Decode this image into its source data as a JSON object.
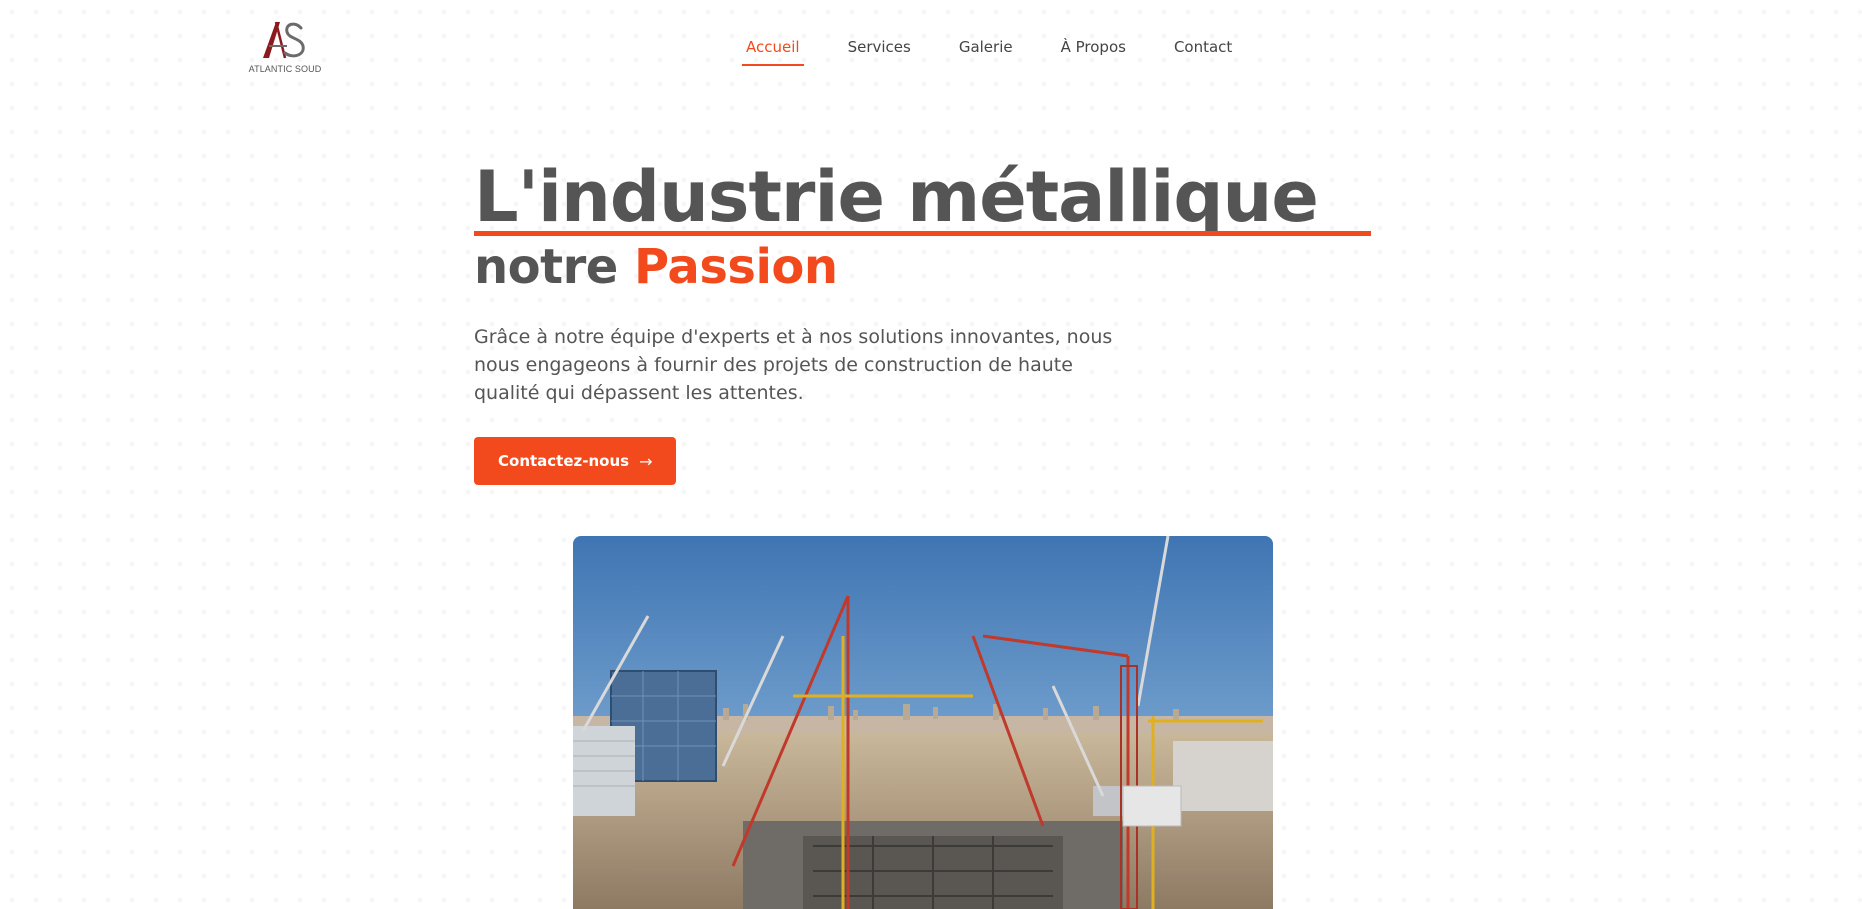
{
  "header": {
    "logo_text": "ATLANTIC SOUD",
    "logo_mark": "AS",
    "nav": [
      {
        "label": "Accueil",
        "active": true
      },
      {
        "label": "Services",
        "active": false
      },
      {
        "label": "Galerie",
        "active": false
      },
      {
        "label": "À Propos",
        "active": false
      },
      {
        "label": "Contact",
        "active": false
      }
    ]
  },
  "hero": {
    "title_line1": "L'industrie métallique",
    "title_line2_prefix": "notre ",
    "title_line2_accent": "Passion",
    "description": "Grâce à notre équipe d'experts et à nos solutions innovantes, nous nous engageons à fournir des projets de construction de haute qualité qui dépassent les attentes.",
    "cta_label": "Contactez-nous",
    "cta_icon": "arrow-right-icon"
  },
  "image": {
    "subject": "construction-site-with-cranes-photo"
  },
  "colors": {
    "accent": "#f24a1d",
    "text": "#555555",
    "logo_red": "#8b1a1f",
    "logo_gray": "#6b6b6b"
  }
}
